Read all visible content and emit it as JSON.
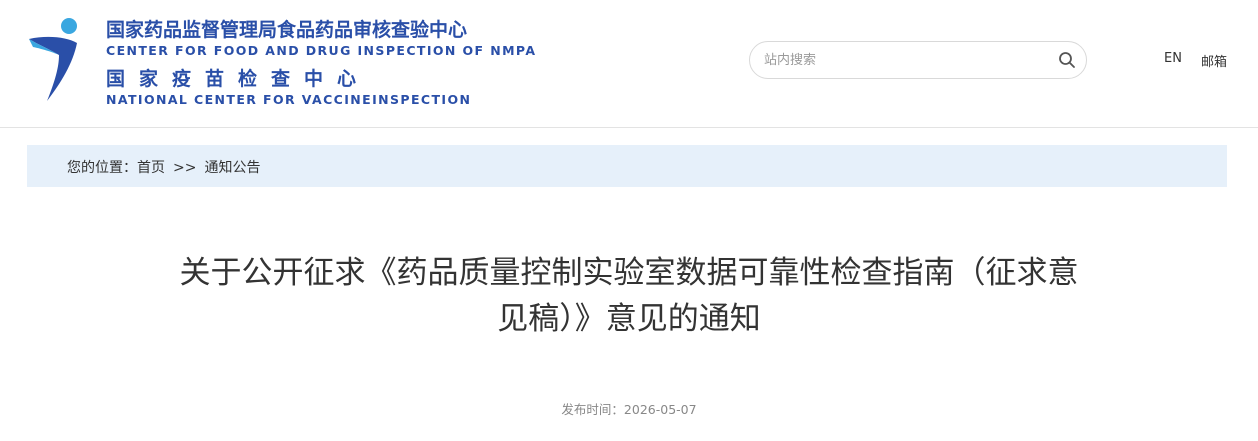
{
  "header": {
    "org_name_cn": "国家药品监督管理局食品药品审核查验中心",
    "org_name_en": "CENTER FOR FOOD AND DRUG INSPECTION OF NMPA",
    "vaccine_center_cn": "国家疫苗检查中心",
    "vaccine_center_en": "NATIONAL CENTER FOR VACCINEINSPECTION",
    "search": {
      "placeholder": "站内搜索",
      "value": ""
    },
    "nav": {
      "english": "EN",
      "mail": "邮箱"
    }
  },
  "breadcrumb": {
    "prefix": "您的位置：",
    "home": "首页",
    "separator": ">>",
    "current": "通知公告"
  },
  "article": {
    "title_line1": "关于公开征求《药品质量控制实验室数据可靠性检查指南（征求意",
    "title_line2": "见稿）》意见的通知",
    "publish_label": "发布时间：",
    "publish_date": "2026-05-07"
  },
  "colors": {
    "brand_blue": "#2a4fa8",
    "logo_light_blue": "#3aa7e0",
    "breadcrumb_bg": "#e6f0fa"
  },
  "icons": [
    "logo-mark",
    "search-icon"
  ]
}
